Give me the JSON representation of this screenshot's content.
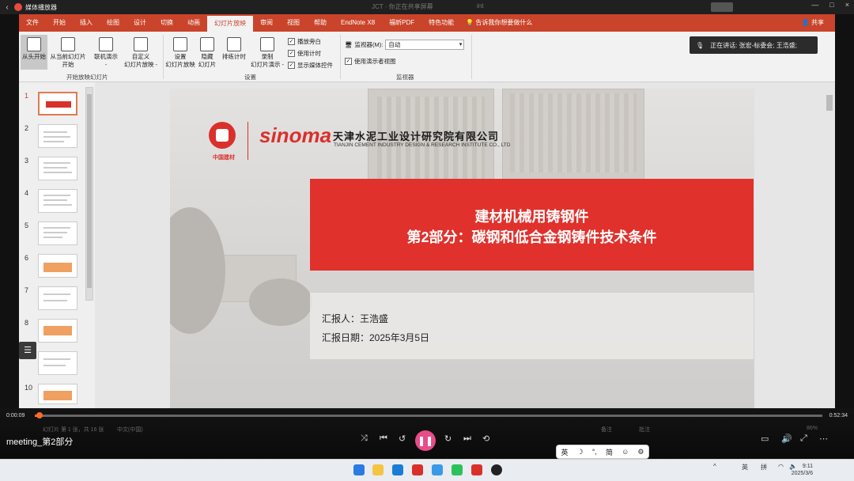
{
  "player_window": {
    "title": "媒体播放器",
    "back_icon": "back-arrow-icon"
  },
  "ghost_text": {
    "a": "JCT  ·  你正在共享屏幕",
    "b": "int"
  },
  "window_controls": [
    "—",
    "□",
    "×"
  ],
  "stop_share_label": "",
  "menu": {
    "tabs": [
      "文件",
      "开始",
      "插入",
      "绘图",
      "设计",
      "切换",
      "动画",
      "幻灯片放映",
      "审阅",
      "视图",
      "帮助",
      "EndNote X8",
      "福昕PDF",
      "特色功能"
    ],
    "active_index": 7,
    "tell_me": "告诉我你想要做什么",
    "share": "共享"
  },
  "ribbon": {
    "buttons": [
      {
        "label": "从头开始",
        "selected": true
      },
      {
        "label": "从当前幻灯片\n开始"
      },
      {
        "label": "联机演示\n-"
      },
      {
        "label": "自定义\n幻灯片放映 -"
      },
      {
        "label": "设置\n幻灯片放映"
      },
      {
        "label": "隐藏\n幻灯片"
      },
      {
        "label": "排练计时"
      },
      {
        "label": "录制\n幻灯片演示 -"
      }
    ],
    "checkboxes": [
      {
        "label": "播放旁白",
        "checked": true
      },
      {
        "label": "使用计时",
        "checked": true
      },
      {
        "label": "显示媒体控件",
        "checked": true
      }
    ],
    "monitor_label": "监视器(M):",
    "monitor_value": "自动",
    "presenter_view_label": "使用演示者视图",
    "groups": [
      "开始放映幻灯片",
      "设置",
      "监视器"
    ]
  },
  "speaking": {
    "text": "正在讲话: 张宏-标委会; 王浩盛;"
  },
  "thumbnails": [
    "1",
    "2",
    "3",
    "4",
    "5",
    "6",
    "7",
    "8",
    "9",
    "10"
  ],
  "slide": {
    "logo_cn": "中国建材",
    "brand": "sinoma",
    "company_cn": "天津水泥工业设计研究院有限公司",
    "company_en": "TIANJIN CEMENT INDUSTRY DESIGN & RESEARCH INSTITUTE CO., LTD",
    "title_line1": "建材机械用铸钢件",
    "title_line2": "第2部分：碳钢和低合金钢铸件技术条件",
    "reporter": "汇报人：王浩盛",
    "report_date": "汇报日期：2025年3月5日"
  },
  "player": {
    "time_current": "0:00:09",
    "time_total": "0:52:34",
    "file_name": "meeting_第2部分",
    "progress": 0.003
  },
  "status_ghost": {
    "slide_info": "幻灯片 第 1 张，共 16 张",
    "lang": "中文(中国)",
    "notes": "备注",
    "comments": "批注",
    "zoom": "86%"
  },
  "ime": {
    "items": [
      "英",
      "简"
    ]
  },
  "clock": {
    "time": "9:11",
    "date": "2025/3/6"
  },
  "tray": {
    "lang": "英",
    "ime": "拼"
  }
}
